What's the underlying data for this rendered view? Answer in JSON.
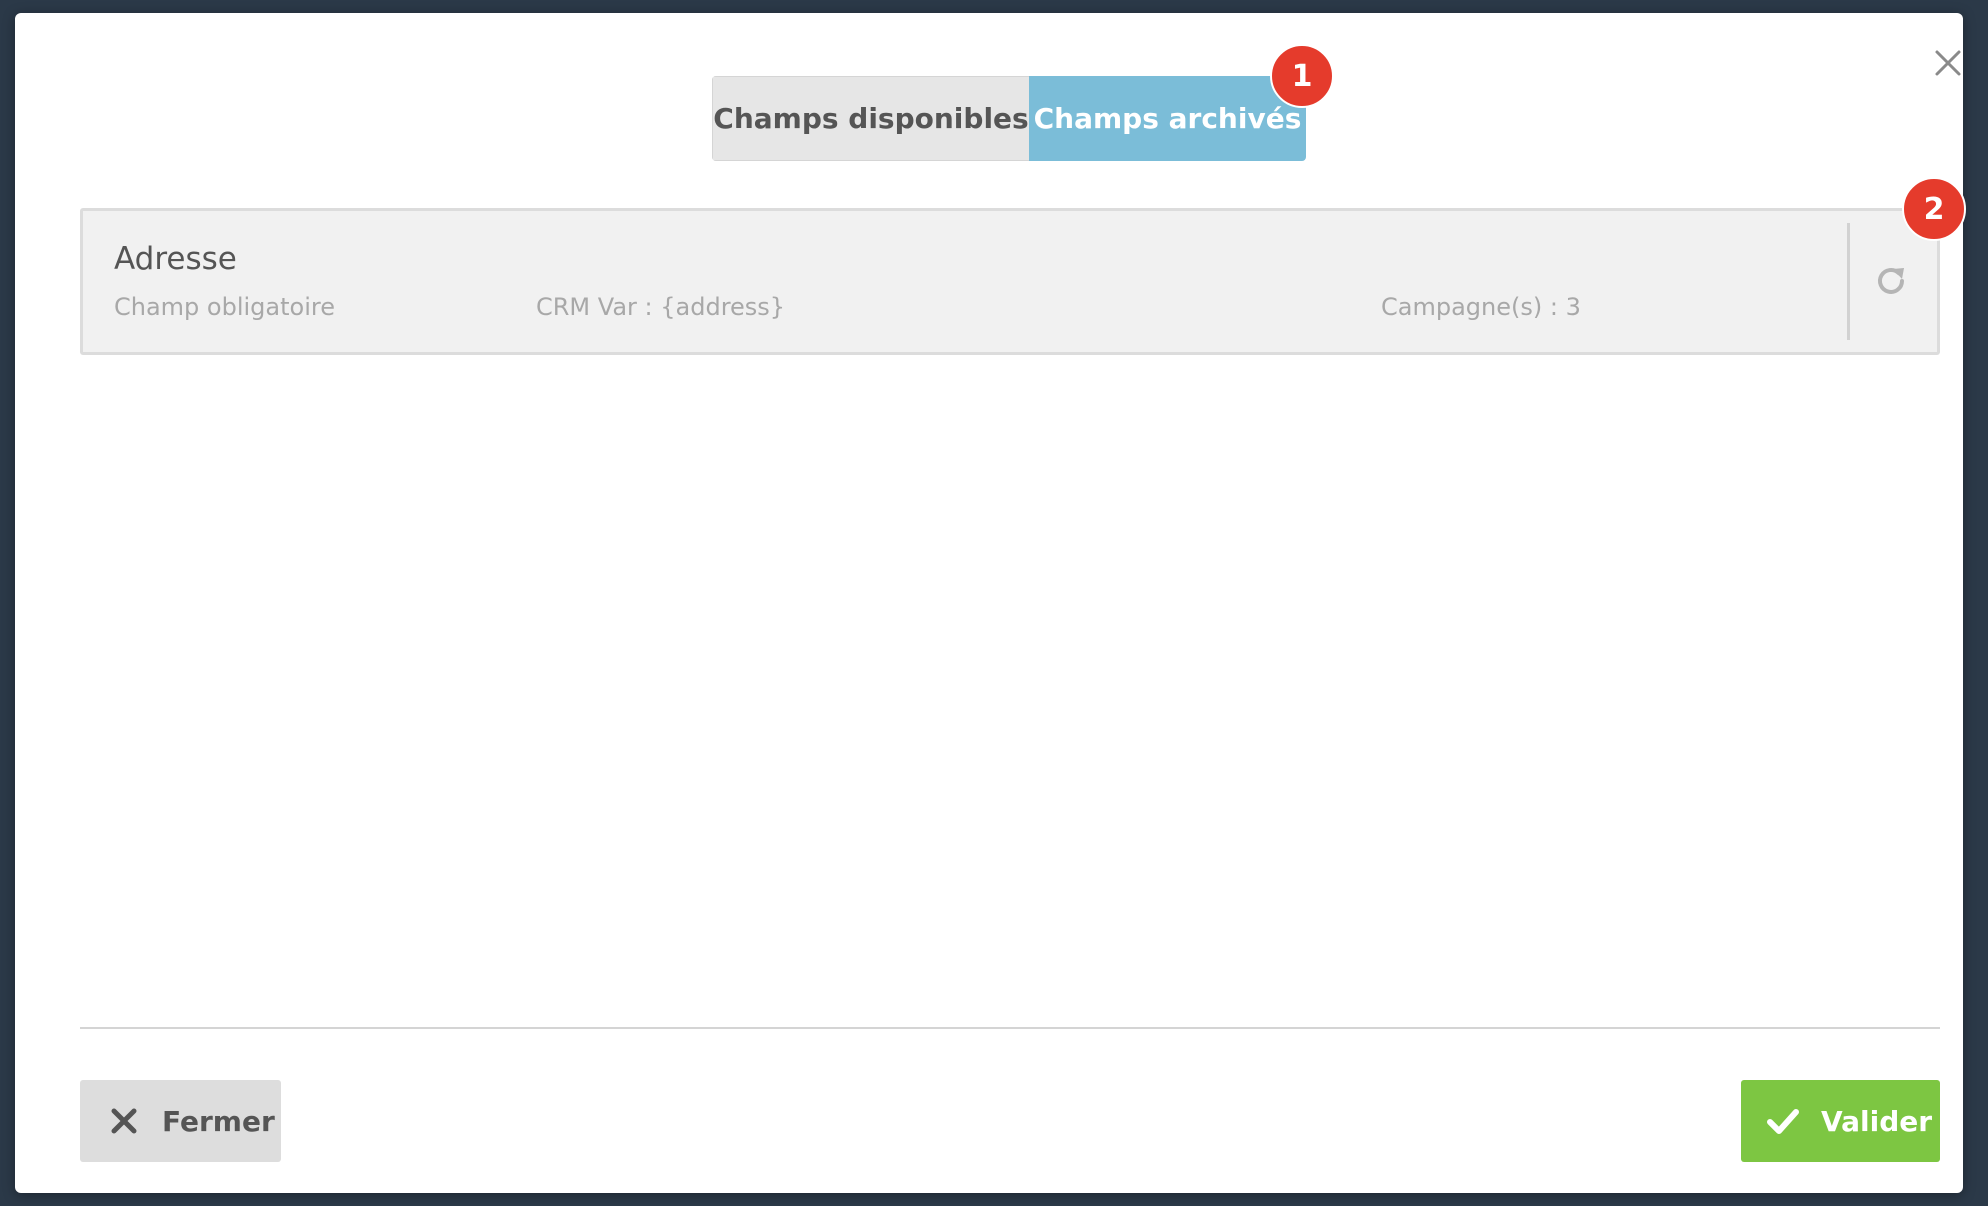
{
  "tabs": [
    {
      "label": "Champs disponibles",
      "active": false
    },
    {
      "label": "Champs archivés",
      "active": true
    }
  ],
  "callouts": [
    "1",
    "2"
  ],
  "archived_fields": [
    {
      "name": "Adresse",
      "required_label": "Champ obligatoire",
      "crm_var": "CRM Var : {address}",
      "campaigns": "Campagne(s) : 3",
      "action_icon": "restore-icon"
    }
  ],
  "footer": {
    "close_label": "Fermer",
    "close_icon": "x-icon",
    "validate_label": "Valider",
    "validate_icon": "check-icon"
  },
  "colors": {
    "active_tab": "#7bbdd8",
    "validate_button": "#7dc642",
    "callout_badge": "#e53b2c"
  }
}
